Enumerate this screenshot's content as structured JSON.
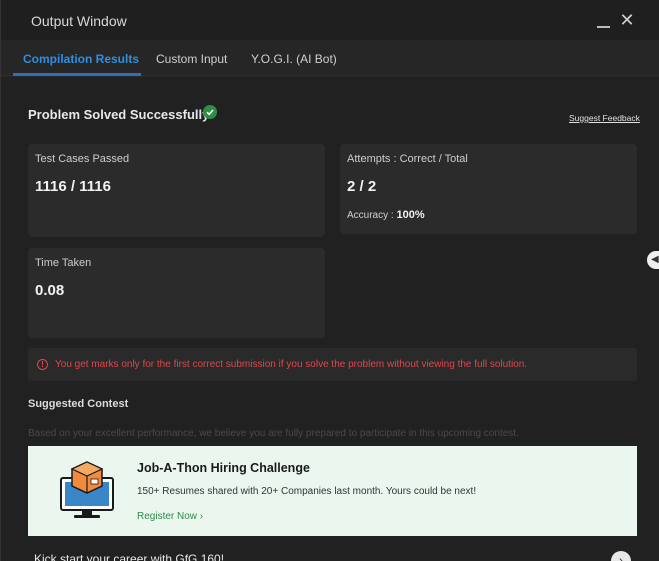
{
  "window": {
    "title": "Output Window"
  },
  "tabs": [
    {
      "label": "Compilation Results"
    },
    {
      "label": "Custom Input"
    },
    {
      "label": "Y.O.G.I. (AI Bot)"
    }
  ],
  "result": {
    "status": "Problem Solved Successfully",
    "feedback_link": "Suggest Feedback"
  },
  "cards": {
    "test_cases": {
      "label": "Test Cases Passed",
      "value": "1116 / 1116"
    },
    "attempts": {
      "label": "Attempts : Correct / Total",
      "value": "2 / 2",
      "accuracy_label": "Accuracy :",
      "accuracy_value": "100%"
    },
    "time": {
      "label": "Time Taken",
      "value": "0.08"
    }
  },
  "warning": {
    "text": "You get marks only for the first correct submission if you solve the problem without viewing the full solution."
  },
  "contest": {
    "heading": "Suggested Contest",
    "description": "Based on your excellent performance, we believe you are fully prepared to participate in this upcoming contest.",
    "promo_title": "Job-A-Thon Hiring Challenge",
    "promo_subtitle": "150+ Resumes shared with 20+ Companies last month. Yours could be next!",
    "promo_link": "Register Now ›"
  },
  "footer": {
    "kickstart": "Kick start your career with GfG 160!"
  },
  "colors": {
    "accent": "#2f8d46",
    "tab_active": "#2f8ee0",
    "error": "#e0464a"
  }
}
